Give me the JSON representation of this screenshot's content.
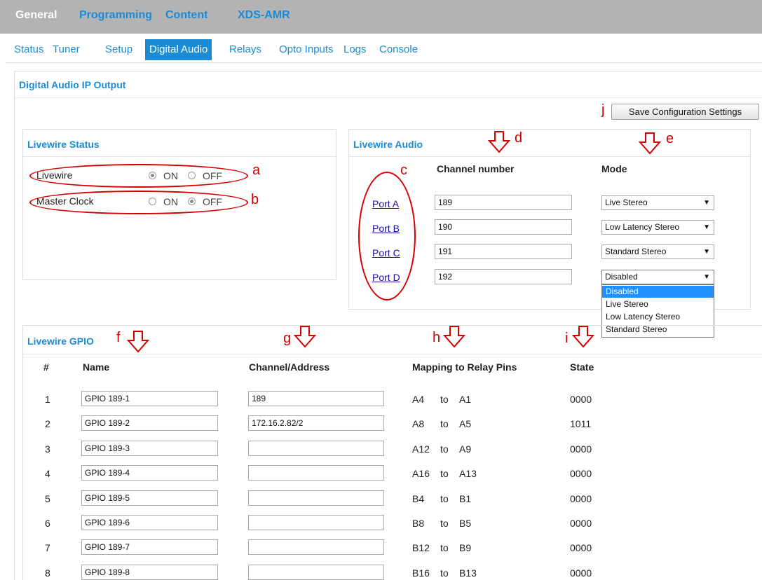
{
  "top_nav": {
    "items": [
      {
        "label": "General",
        "active": true
      },
      {
        "label": "Programming",
        "active": false
      },
      {
        "label": "Content",
        "active": false
      },
      {
        "label": "XDS-AMR",
        "active": false
      }
    ]
  },
  "sub_nav": {
    "items": [
      {
        "label": "Status",
        "active": false
      },
      {
        "label": "Tuner",
        "active": false
      },
      {
        "label": "Setup",
        "active": false
      },
      {
        "label": "Digital Audio",
        "active": true
      },
      {
        "label": "Relays",
        "active": false
      },
      {
        "label": "Opto Inputs",
        "active": false
      },
      {
        "label": "Logs",
        "active": false
      },
      {
        "label": "Console",
        "active": false
      }
    ]
  },
  "main": {
    "title": "Digital Audio IP Output",
    "save_label": "Save Configuration Settings"
  },
  "livewire_status": {
    "title": "Livewire Status",
    "rows": [
      {
        "label": "Livewire",
        "on_label": "ON",
        "off_label": "OFF",
        "selected": "ON"
      },
      {
        "label": "Master Clock",
        "on_label": "ON",
        "off_label": "OFF",
        "selected": "OFF"
      }
    ]
  },
  "livewire_audio": {
    "title": "Livewire Audio",
    "col_channel": "Channel number",
    "col_mode": "Mode",
    "ports": [
      {
        "label": "Port A",
        "channel": "189",
        "mode": "Live Stereo"
      },
      {
        "label": "Port B",
        "channel": "190",
        "mode": "Low Latency Stereo"
      },
      {
        "label": "Port C",
        "channel": "191",
        "mode": "Standard Stereo"
      },
      {
        "label": "Port D",
        "channel": "192",
        "mode": "Disabled"
      }
    ],
    "mode_options": [
      "Disabled",
      "Live Stereo",
      "Low Latency Stereo",
      "Standard Stereo"
    ],
    "open_dropdown_selected": "Disabled"
  },
  "livewire_gpio": {
    "title": "Livewire GPIO",
    "headers": {
      "num": "#",
      "name": "Name",
      "address": "Channel/Address",
      "mapping": "Mapping to Relay Pins",
      "state": "State"
    },
    "connector": "to",
    "rows": [
      {
        "num": "1",
        "name": "GPIO 189-1",
        "address": "189",
        "from": "A4",
        "to": "A1",
        "state": "0000"
      },
      {
        "num": "2",
        "name": "GPIO 189-2",
        "address": "172.16.2.82/2",
        "from": "A8",
        "to": "A5",
        "state": "1011"
      },
      {
        "num": "3",
        "name": "GPIO 189-3",
        "address": "",
        "from": "A12",
        "to": "A9",
        "state": "0000"
      },
      {
        "num": "4",
        "name": "GPIO 189-4",
        "address": "",
        "from": "A16",
        "to": "A13",
        "state": "0000"
      },
      {
        "num": "5",
        "name": "GPIO 189-5",
        "address": "",
        "from": "B4",
        "to": "B1",
        "state": "0000"
      },
      {
        "num": "6",
        "name": "GPIO 189-6",
        "address": "",
        "from": "B8",
        "to": "B5",
        "state": "0000"
      },
      {
        "num": "7",
        "name": "GPIO 189-7",
        "address": "",
        "from": "B12",
        "to": "B9",
        "state": "0000"
      },
      {
        "num": "8",
        "name": "GPIO 189-8",
        "address": "",
        "from": "B16",
        "to": "B13",
        "state": "0000"
      }
    ]
  },
  "annotations": {
    "a": "a",
    "b": "b",
    "c": "c",
    "d": "d",
    "e": "e",
    "f": "f",
    "g": "g",
    "h": "h",
    "i": "i",
    "j": "j",
    "color": "#d40000"
  },
  "colors": {
    "accent": "#1b8bd6",
    "top_bar": "#b3b3b3",
    "link": "#1a0dab",
    "selection": "#1e90ff"
  }
}
